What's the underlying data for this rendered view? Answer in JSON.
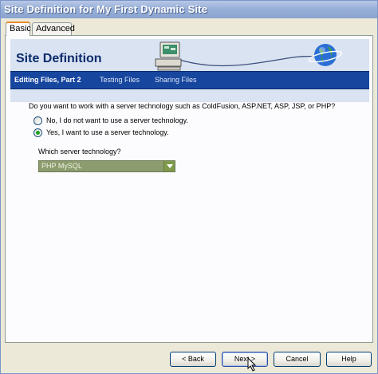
{
  "window": {
    "title": "Site Definition for My First Dynamic Site"
  },
  "tabs": [
    {
      "label": "Basic",
      "active": true
    },
    {
      "label": "Advanced",
      "active": false
    }
  ],
  "banner": {
    "title": "Site Definition",
    "steps": [
      {
        "label": "Editing Files, Part 2",
        "current": true
      },
      {
        "label": "Testing Files",
        "current": false
      },
      {
        "label": "Sharing Files",
        "current": false
      }
    ]
  },
  "form": {
    "question": "Do you want to work with a server technology such as ColdFusion, ASP.NET, ASP, JSP, or PHP?",
    "options": [
      {
        "label": "No, I do not want to use a server technology.",
        "checked": false
      },
      {
        "label": "Yes, I want to use a server technology.",
        "checked": true
      }
    ],
    "select_label": "Which server technology?",
    "select_value": "PHP MySQL"
  },
  "buttons": {
    "back": "< Back",
    "next": "Next >",
    "cancel": "Cancel",
    "help": "Help"
  },
  "colors": {
    "nav_bar": "#17469e",
    "banner_bg": "#d9e3f2",
    "select_bg": "#8c9c6e"
  },
  "icons": [
    "computer-icon",
    "globe-icon",
    "chevron-down-icon",
    "mouse-pointer-icon"
  ]
}
